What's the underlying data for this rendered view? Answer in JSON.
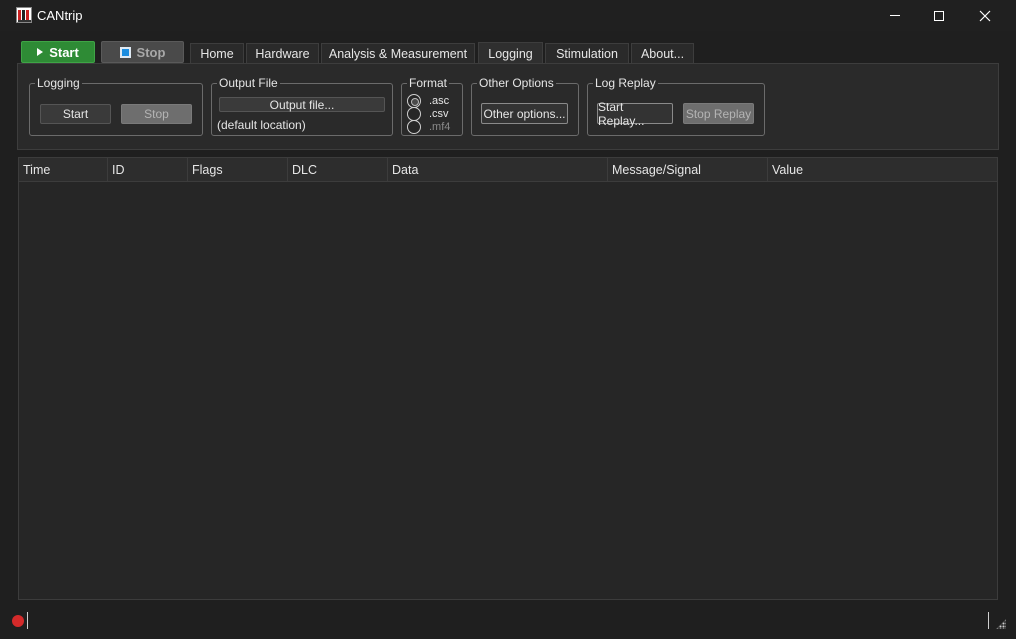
{
  "window": {
    "title": "CANtrip",
    "icon": "cantrip-logo-icon",
    "controls": [
      "minimize-icon",
      "maximize-icon",
      "close-icon"
    ]
  },
  "toolbar": {
    "start_label": "Start",
    "stop_label": "Stop",
    "start_color": "#2e8b35",
    "stop_icon_color": "#1c8de0"
  },
  "tabs": [
    {
      "label": "Home",
      "active": false
    },
    {
      "label": "Hardware",
      "active": false
    },
    {
      "label": "Analysis & Measurement",
      "active": false
    },
    {
      "label": "Logging",
      "active": true
    },
    {
      "label": "Stimulation",
      "active": false
    },
    {
      "label": "About...",
      "active": false
    }
  ],
  "logging": {
    "group_title": "Logging",
    "start_label": "Start",
    "stop_label": "Stop",
    "output_group_title": "Output File",
    "output_button": "Output file...",
    "output_location": "(default location)",
    "format_group_title": "Format",
    "formats": [
      {
        "label": ".asc",
        "checked": true,
        "enabled": true
      },
      {
        "label": ".csv",
        "checked": false,
        "enabled": true
      },
      {
        "label": ".mf4",
        "checked": false,
        "enabled": false
      }
    ],
    "other_group_title": "Other Options",
    "other_button": "Other options...",
    "replay_group_title": "Log Replay",
    "start_replay": "Start Replay...",
    "stop_replay": "Stop Replay"
  },
  "table": {
    "columns": [
      "Time",
      "ID",
      "Flags",
      "DLC",
      "Data",
      "Message/Signal",
      "Value"
    ],
    "rows": []
  },
  "status": {
    "indicator_color": "#d42a2a"
  }
}
